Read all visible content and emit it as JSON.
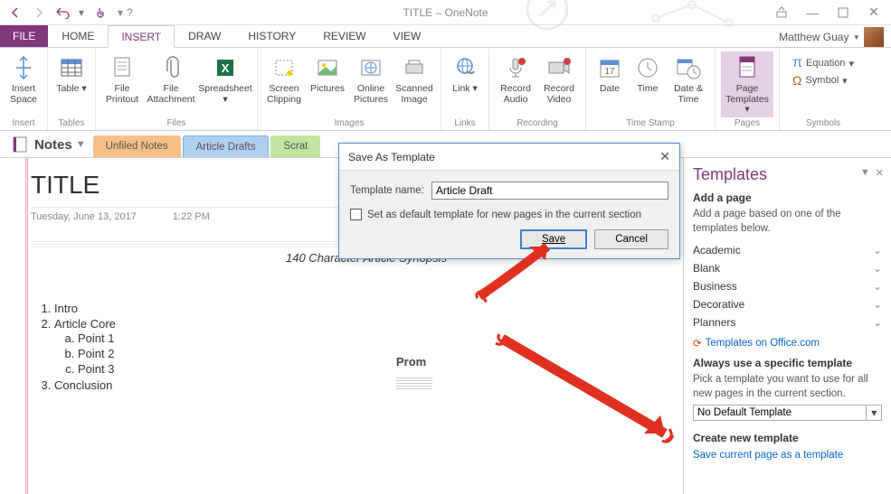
{
  "app": {
    "title": "TITLE – OneNote",
    "user": "Matthew Guay"
  },
  "menutabs": {
    "file": "FILE",
    "tabs": [
      "HOME",
      "INSERT",
      "DRAW",
      "HISTORY",
      "REVIEW",
      "VIEW"
    ],
    "active": 1
  },
  "ribbon": {
    "groups": [
      {
        "label": "Insert",
        "items": [
          {
            "label": "Insert Space"
          }
        ]
      },
      {
        "label": "Tables",
        "items": [
          {
            "label": "Table"
          }
        ]
      },
      {
        "label": "Files",
        "items": [
          {
            "label": "File Printout"
          },
          {
            "label": "File Attachment"
          },
          {
            "label": "Spreadsheet"
          }
        ]
      },
      {
        "label": "Images",
        "items": [
          {
            "label": "Screen Clipping"
          },
          {
            "label": "Pictures"
          },
          {
            "label": "Online Pictures"
          },
          {
            "label": "Scanned Image"
          }
        ]
      },
      {
        "label": "Links",
        "items": [
          {
            "label": "Link"
          }
        ]
      },
      {
        "label": "Recording",
        "items": [
          {
            "label": "Record Audio"
          },
          {
            "label": "Record Video"
          }
        ]
      },
      {
        "label": "Time Stamp",
        "items": [
          {
            "label": "Date"
          },
          {
            "label": "Time"
          },
          {
            "label": "Date & Time"
          }
        ]
      },
      {
        "label": "Pages",
        "items": [
          {
            "label": "Page Templates"
          }
        ]
      },
      {
        "label": "Symbols",
        "equation": "Equation",
        "symbol": "Symbol"
      }
    ]
  },
  "notebook": {
    "name": "Notes",
    "sections": [
      "Unfiled Notes",
      "Article Drafts",
      "Scrat"
    ],
    "active": 1
  },
  "page": {
    "title": "TITLE",
    "date": "Tuesday, June 13, 2017",
    "time": "1:22 PM",
    "synopsis": "140 Character Article Synopsis",
    "prom": "Prom",
    "outline": {
      "i1": "Intro",
      "i2": "Article Core",
      "i2a": "Point 1",
      "i2b": "Point 2",
      "i2c": "Point 3",
      "i3": "Conclusion"
    }
  },
  "templates": {
    "title": "Templates",
    "add_heading": "Add a page",
    "add_text": "Add a page based on one of the templates below.",
    "cats": [
      "Academic",
      "Blank",
      "Business",
      "Decorative",
      "Planners"
    ],
    "office_link": "Templates on Office.com",
    "always_heading": "Always use a specific template",
    "always_text": "Pick a template you want to use for all new pages in the current section.",
    "select_value": "No Default Template",
    "create_heading": "Create new template",
    "create_link": "Save current page as a template"
  },
  "dialog": {
    "title": "Save As Template",
    "name_label": "Template name:",
    "name_value": "Article Draft",
    "checkbox_label": "Set as default template for new pages in the current section",
    "save": "Save",
    "cancel": "Cancel"
  }
}
